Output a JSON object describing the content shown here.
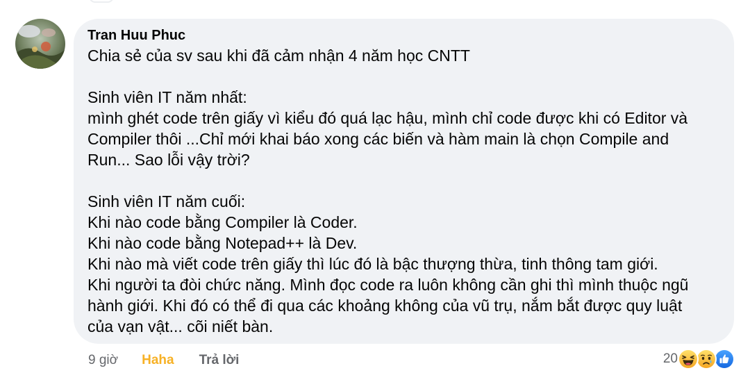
{
  "comment": {
    "author": "Tran Huu Phuc",
    "lines": [
      "Chia sẻ của sv sau khi đã cảm nhận 4 năm học CNTT",
      "",
      "Sinh viên IT năm nhất:",
      "mình ghét code trên giấy vì kiểu đó quá lạc hậu, mình chỉ code được khi có Editor và",
      "Compiler thôi ...Chỉ mới khai báo xong các biến và hàm main là chọn Compile and",
      "Run... Sao lỗi vậy trời?",
      "",
      "Sinh viên IT năm cuối:",
      "Khi nào code bằng Compiler là Coder.",
      "Khi nào code bằng Notepad++ là Dev.",
      "Khi nào mà viết code trên giấy thì lúc đó là bậc thượng thừa, tinh thông tam giới.",
      "Khi người ta đòi chức năng. Mình đọc code ra luôn không cần ghi thì mình thuộc ngũ",
      "hành giới. Khi đó có thể đi qua các khoảng không của vũ trụ, nắm bắt được quy luật",
      "của vạn vật... cõi niết bàn."
    ]
  },
  "actions": {
    "time": "9 giờ",
    "reaction_label": "Haha",
    "reply_label": "Trả lời"
  },
  "reactions": {
    "count": "20",
    "icons": [
      "haha-icon",
      "sad-icon",
      "like-icon"
    ]
  },
  "colors": {
    "bubble_bg": "#f0f2f5",
    "haha_accent": "#f7b125",
    "secondary_text": "#65676b",
    "like_blue": "#1877f2"
  }
}
